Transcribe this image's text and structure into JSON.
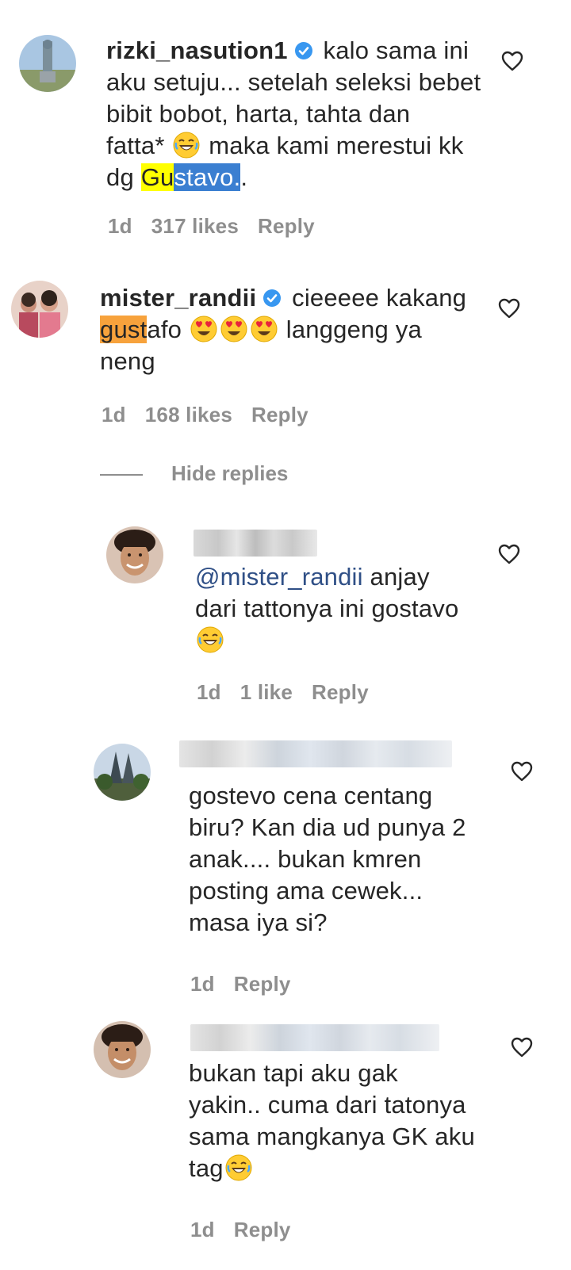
{
  "colors": {
    "text": "#262626",
    "meta": "#8e8e8e",
    "mention": "#2f4f86",
    "verified": "#3897f0",
    "highlight_yellow": "#ffff00",
    "highlight_blue": "#3b7fd1",
    "highlight_orange": "#f7a23c"
  },
  "comments": [
    {
      "username": "rizki_nasution1",
      "verified": true,
      "lines": {
        "l1": "kalo sama ini",
        "l2": "aku setuju... setelah seleksi bebet",
        "l3": "bibit bobot, harta, tahta dan",
        "l4a": "fatta*",
        "l4b": "maka kami merestui kk",
        "l5a": "dg ",
        "l5_hl1": "Gu",
        "l5_hl2": "stavo.",
        "l5b": "."
      },
      "time": "1d",
      "likes": "317 likes",
      "reply": "Reply"
    },
    {
      "username": "mister_randii",
      "verified": true,
      "lines": {
        "l1": "cieeeee kakang",
        "l2_hl": "gust",
        "l2a": "afo",
        "l2b": "langgeng ya",
        "l3": "neng"
      },
      "time": "1d",
      "likes": "168 likes",
      "reply": "Reply"
    }
  ],
  "hide_replies": "Hide replies",
  "replies": [
    {
      "mention": "@mister_randii",
      "lines": {
        "l1": "anjay",
        "l2": "dari tattonya ini gostavo"
      },
      "time": "1d",
      "likes": "1 like",
      "reply": "Reply"
    },
    {
      "lines": {
        "l1": "gostevo cena centang",
        "l2": "biru? Kan dia ud punya 2",
        "l3": "anak.... bukan kmren",
        "l4": "posting ama cewek...",
        "l5": "masa iya si?"
      },
      "time": "1d",
      "reply": "Reply"
    },
    {
      "lines": {
        "l1": "bukan tapi aku gak",
        "l2": "yakin.. cuma dari tatonya",
        "l3": "sama mangkanya GK aku",
        "l4": "tag"
      },
      "time": "1d",
      "reply": "Reply"
    }
  ]
}
